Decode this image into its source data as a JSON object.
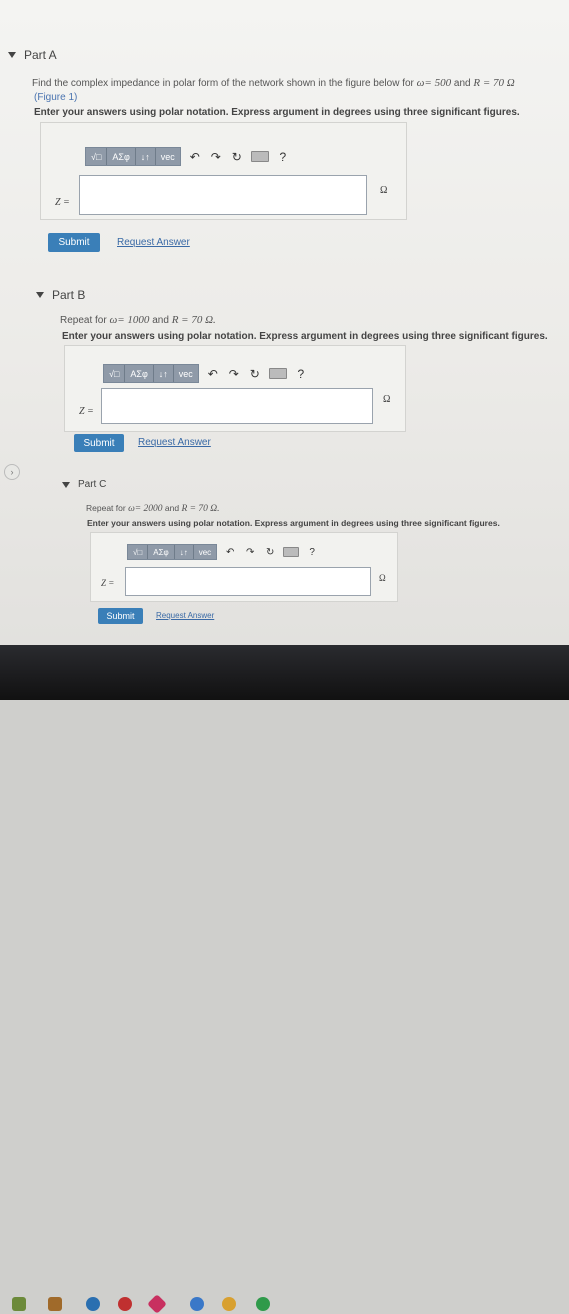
{
  "toolbar": {
    "templates_label": "√□",
    "greek_label": "ΑΣφ",
    "arrows_label": "↓↑",
    "vec_label": "vec",
    "undo_icon": "↶",
    "redo_icon": "↷",
    "reset_icon": "↻",
    "help_label": "?"
  },
  "part_a": {
    "title": "Part A",
    "prompt_1": "Find the complex impedance in polar form of the network shown in the figure below for ",
    "omega_eq": "ω= 500",
    "and": " and ",
    "r_eq": "R = 70 Ω",
    "figure_link": "(Figure 1)",
    "instruction": "Enter your answers using polar notation. Express argument in degrees using three significant figures.",
    "z_label": "Z =",
    "unit": "Ω",
    "submit": "Submit",
    "request": "Request Answer"
  },
  "part_b": {
    "title": "Part B",
    "prompt_1": "Repeat for ",
    "omega_eq": "ω= 1000",
    "and": " and ",
    "r_eq": "R = 70 Ω.",
    "instruction": "Enter your answers using polar notation. Express argument in degrees using three significant figures.",
    "z_label": "Z =",
    "unit": "Ω",
    "submit": "Submit",
    "request": "Request Answer"
  },
  "part_c": {
    "title": "Part C",
    "prompt_1": "Repeat for ",
    "omega_eq": "ω= 2000",
    "and": " and ",
    "r_eq": "R = 70 Ω.",
    "instruction": "Enter your answers using polar notation. Express argument in degrees using three significant figures.",
    "z_label": "Z =",
    "unit": "Ω",
    "submit": "Submit",
    "request": "Request Answer"
  },
  "side_nav": {
    "icon": "›"
  }
}
